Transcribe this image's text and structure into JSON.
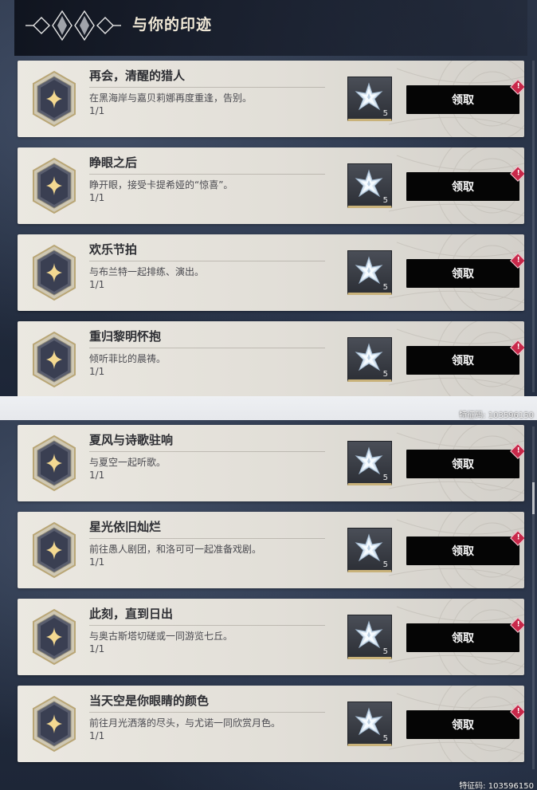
{
  "header": {
    "title": "与你的印迹",
    "emblem_icon": "crystal-emblem-icon"
  },
  "colors": {
    "card_bg": "#e6e3dc",
    "claim_button": "#050505",
    "alert": "#c8284a",
    "badge_gold": "#c9b27a",
    "badge_dark": "#3a3f52"
  },
  "claim_label": "领取",
  "icons": {
    "badge": "hexagon-star-badge-icon",
    "reward": "crystal-star-icon",
    "alert": "exclamation-alert-icon"
  },
  "tasks_top": [
    {
      "title": "再会，清醒的猎人",
      "desc": "在黑海岸与嘉贝莉娜再度重逢，告别。",
      "progress": "1/1",
      "reward_count": "5"
    },
    {
      "title": "睁眼之后",
      "desc": "睁开眼，接受卡提希娅的“惊喜”。",
      "progress": "1/1",
      "reward_count": "5"
    },
    {
      "title": "欢乐节拍",
      "desc": "与布兰特一起排练、演出。",
      "progress": "1/1",
      "reward_count": "5"
    },
    {
      "title": "重归黎明怀抱",
      "desc": "倾听菲比的晨祷。",
      "progress": "1/1",
      "reward_count": "5"
    }
  ],
  "tasks_bottom": [
    {
      "title": "夏风与诗歌驻响",
      "desc": "与夏空一起听歌。",
      "progress": "1/1",
      "reward_count": "5"
    },
    {
      "title": "星光依旧灿烂",
      "desc": "前往愚人剧团，和洛可可一起准备戏剧。",
      "progress": "1/1",
      "reward_count": "5"
    },
    {
      "title": "此刻，直到日出",
      "desc": "与奥古斯塔切磋或一同游览七丘。",
      "progress": "1/1",
      "reward_count": "5"
    },
    {
      "title": "当天空是你眼睛的颜色",
      "desc": "前往月光洒落的尽头，与尤诺一同欣赏月色。",
      "progress": "1/1",
      "reward_count": "5"
    }
  ],
  "watermarks": [
    "特征码: 103596150",
    "特征码: 103596150"
  ]
}
